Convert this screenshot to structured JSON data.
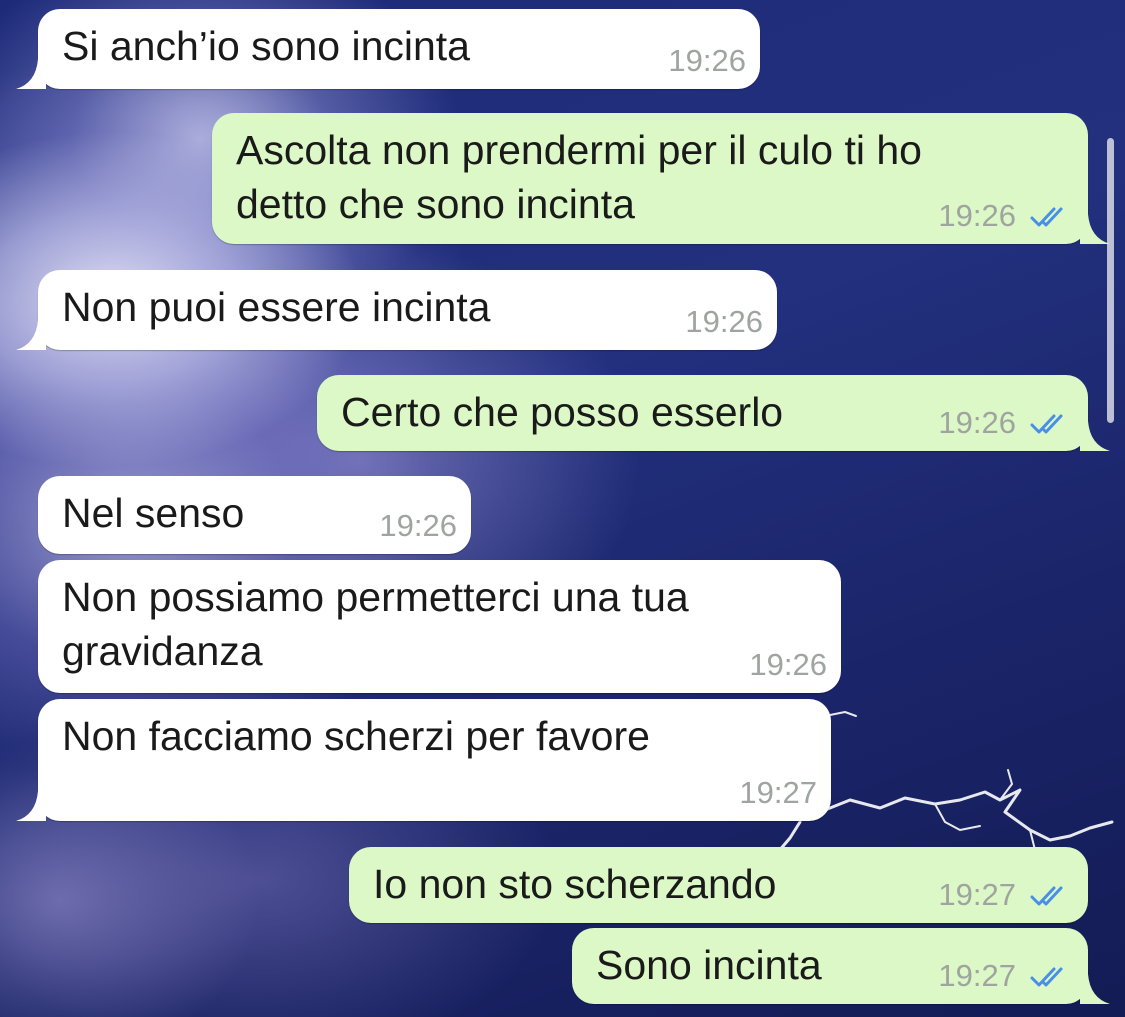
{
  "messages": [
    {
      "direction": "incoming",
      "text": "Si anch’io sono incinta",
      "time": "19:26"
    },
    {
      "direction": "outgoing",
      "text_lines": [
        "Ascolta non prendermi per il culo ti ho",
        "detto che sono incinta"
      ],
      "time": "19:26",
      "status_icon": "double-check-icon"
    },
    {
      "direction": "incoming",
      "text": "Non puoi essere incinta",
      "time": "19:26"
    },
    {
      "direction": "outgoing",
      "text": "Certo che posso esserlo",
      "time": "19:26",
      "status_icon": "double-check-icon"
    },
    {
      "direction": "incoming",
      "text": "Nel senso",
      "time": "19:26"
    },
    {
      "direction": "incoming",
      "text_lines": [
        "Non possiamo permetterci una tua",
        "gravidanza"
      ],
      "time": "19:26"
    },
    {
      "direction": "incoming",
      "text": "Non facciamo scherzi per favore",
      "time": "19:27"
    },
    {
      "direction": "outgoing",
      "text": "Io non sto scherzando",
      "time": "19:27",
      "status_icon": "double-check-icon"
    },
    {
      "direction": "outgoing",
      "text": "Sono incinta",
      "time": "19:27",
      "status_icon": "double-check-icon"
    }
  ],
  "colors": {
    "incoming_bubble": "#ffffff",
    "outgoing_bubble": "#dcf8c6",
    "read_tick": "#4a8fe7",
    "timestamp": "#a0a4a0"
  }
}
